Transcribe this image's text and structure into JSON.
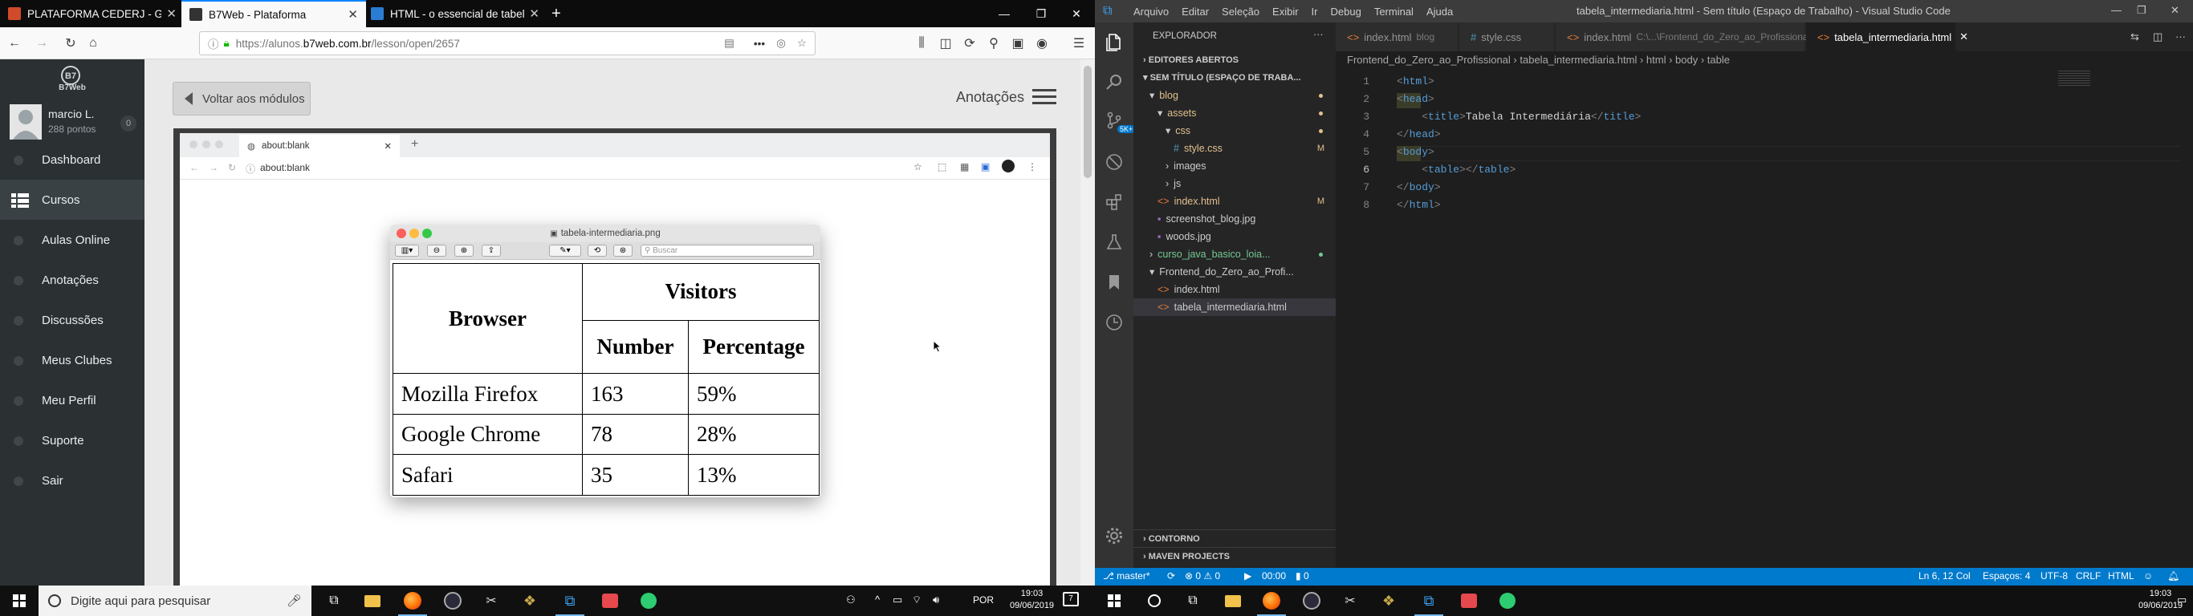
{
  "firefox": {
    "tabs": [
      {
        "title": "PLATAFORMA CEDERJ - GRADU",
        "icon_color": "#d14b2a"
      },
      {
        "title": "B7Web - Plataforma",
        "icon_color": "#333333"
      },
      {
        "title": "HTML - o essencial de tabelo",
        "icon_color": "#2b7cd3"
      }
    ],
    "url_prefix": "https://alunos.",
    "url_domain": "b7web.com.br",
    "url_path": "/lesson/open/2657",
    "url_ellipsis": "•••"
  },
  "sidebar": {
    "logo": "B7Web",
    "user_name": "marcio L.",
    "user_points": "288 pontos",
    "badge": "0",
    "items": [
      {
        "label": "Dashboard",
        "icon": "dashboard-icon"
      },
      {
        "label": "Cursos",
        "icon": "grid-icon"
      },
      {
        "label": "Aulas Online",
        "icon": "video-icon"
      },
      {
        "label": "Anotações",
        "icon": "notes-icon"
      },
      {
        "label": "Discussões",
        "icon": "chat-icon"
      },
      {
        "label": "Meus Clubes",
        "icon": "clubs-icon"
      },
      {
        "label": "Meu Perfil",
        "icon": "user-icon"
      },
      {
        "label": "Suporte",
        "icon": "support-icon"
      },
      {
        "label": "Sair",
        "icon": "logout-icon"
      }
    ]
  },
  "lesson": {
    "back_label": "Voltar aos módulos",
    "annotations_label": "Anotações",
    "inner_tab": "about:blank",
    "inner_url": "about:blank",
    "preview_title": "tabela-intermediaria.png",
    "preview_search": "Buscar",
    "table": {
      "col_browser": "Browser",
      "col_visitors": "Visitors",
      "col_number": "Number",
      "col_percentage": "Percentage",
      "rows": [
        {
          "browser": "Mozilla Firefox",
          "number": "163",
          "percentage": "59%"
        },
        {
          "browser": "Google Chrome",
          "number": "78",
          "percentage": "28%"
        },
        {
          "browser": "Safari",
          "number": "35",
          "percentage": "13%"
        }
      ]
    }
  },
  "vscode": {
    "menu": [
      "Arquivo",
      "Editar",
      "Seleção",
      "Exibir",
      "Ir",
      "Debug",
      "Terminal",
      "Ajuda"
    ],
    "window_title": "tabela_intermediaria.html - Sem título (Espaço de Trabalho) - Visual Studio Code",
    "explorer_title": "EXPLORADOR",
    "open_editors": "EDITORES ABERTOS",
    "workspace": "SEM TÍTULO (ESPAÇO DE TRABA...",
    "tree": [
      {
        "label": "blog",
        "depth": 1,
        "arrow": "▾",
        "type": "folder",
        "mark": "dot",
        "color": "#e2c08d"
      },
      {
        "label": "assets",
        "depth": 2,
        "arrow": "▾",
        "type": "folder",
        "mark": "dot",
        "color": "#e2c08d"
      },
      {
        "label": "css",
        "depth": 3,
        "arrow": "▾",
        "type": "folder",
        "mark": "dot",
        "color": "#e2c08d"
      },
      {
        "label": "style.css",
        "depth": 4,
        "arrow": "#",
        "type": "css",
        "mark": "M",
        "color": "#e2c08d"
      },
      {
        "label": "images",
        "depth": 3,
        "arrow": "›",
        "type": "folder",
        "mark": "",
        "color": "#cccccc"
      },
      {
        "label": "js",
        "depth": 3,
        "arrow": "›",
        "type": "folder",
        "mark": "",
        "color": "#cccccc"
      },
      {
        "label": "index.html",
        "depth": 2,
        "arrow": "<>",
        "type": "html",
        "mark": "M",
        "color": "#e2c08d"
      },
      {
        "label": "screenshot_blog.jpg",
        "depth": 2,
        "arrow": "",
        "type": "img",
        "mark": "",
        "color": "#cccccc"
      },
      {
        "label": "woods.jpg",
        "depth": 2,
        "arrow": "",
        "type": "img",
        "mark": "",
        "color": "#cccccc"
      },
      {
        "label": "curso_java_basico_loia...",
        "depth": 1,
        "arrow": "›",
        "type": "folder",
        "mark": "dot",
        "color": "#73c991"
      },
      {
        "label": "Frontend_do_Zero_ao_Profi...",
        "depth": 1,
        "arrow": "▾",
        "type": "folder",
        "mark": "",
        "color": "#cccccc"
      },
      {
        "label": "index.html",
        "depth": 2,
        "arrow": "<>",
        "type": "html",
        "mark": "",
        "color": "#cccccc"
      },
      {
        "label": "tabela_intermediaria.html",
        "depth": 2,
        "arrow": "<>",
        "type": "html",
        "mark": "",
        "color": "#cccccc",
        "selected": true
      }
    ],
    "outline": "CONTORNO",
    "maven": "MAVEN PROJECTS",
    "tabs": [
      {
        "label": "index.html",
        "sub": "blog",
        "icon": "<>"
      },
      {
        "label": "style.css",
        "sub": "",
        "icon": "#"
      },
      {
        "label": "index.html",
        "sub": "C:\\...\\Frontend_do_Zero_ao_Profissional",
        "icon": "<>"
      },
      {
        "label": "tabela_intermediaria.html",
        "sub": "",
        "icon": "<>"
      }
    ],
    "breadcrumb": [
      "Frontend_do_Zero_ao_Profissional",
      "tabela_intermediaria.html",
      "html",
      "body",
      "table"
    ],
    "code": [
      [
        [
          "tg",
          "<"
        ],
        [
          "tn",
          "html"
        ],
        [
          "tg",
          ">"
        ]
      ],
      [
        [
          "tg",
          "<"
        ],
        [
          "tn",
          "head"
        ],
        [
          "tg",
          ">"
        ]
      ],
      [
        [
          "tx",
          "    "
        ],
        [
          "tg",
          "<"
        ],
        [
          "tn",
          "title"
        ],
        [
          "tg",
          ">"
        ],
        [
          "tx",
          "Tabela Intermediária"
        ],
        [
          "tg",
          "</"
        ],
        [
          "tn",
          "title"
        ],
        [
          "tg",
          ">"
        ]
      ],
      [
        [
          "tg",
          "</"
        ],
        [
          "tn",
          "head"
        ],
        [
          "tg",
          ">"
        ]
      ],
      [
        [
          "tg",
          "<"
        ],
        [
          "tn",
          "body"
        ],
        [
          "tg",
          ">"
        ]
      ],
      [
        [
          "tx",
          "    "
        ],
        [
          "tg",
          "<"
        ],
        [
          "tn",
          "table"
        ],
        [
          "tg",
          "></"
        ],
        [
          "tn",
          "table"
        ],
        [
          "tg",
          ">"
        ]
      ],
      [
        [
          "tg",
          "</"
        ],
        [
          "tn",
          "body"
        ],
        [
          "tg",
          ">"
        ]
      ],
      [
        [
          "tg",
          "</"
        ],
        [
          "tn",
          "html"
        ],
        [
          "tg",
          ">"
        ]
      ]
    ],
    "status": {
      "branch": "master*",
      "errors": "0",
      "warnings": "0",
      "time": "00:00",
      "count": "0",
      "position": "Ln 6, 12 Col",
      "spaces": "Espaços: 4",
      "encoding": "UTF-8",
      "eol": "CRLF",
      "language": "HTML"
    }
  },
  "taskbar": {
    "search_placeholder": "Digite aqui para pesquisar",
    "lang": "POR",
    "time_left": "19:03",
    "date_left": "09/06/2019",
    "time_right": "19:03",
    "date_right": "09/06/2019",
    "notif_count": "7"
  }
}
